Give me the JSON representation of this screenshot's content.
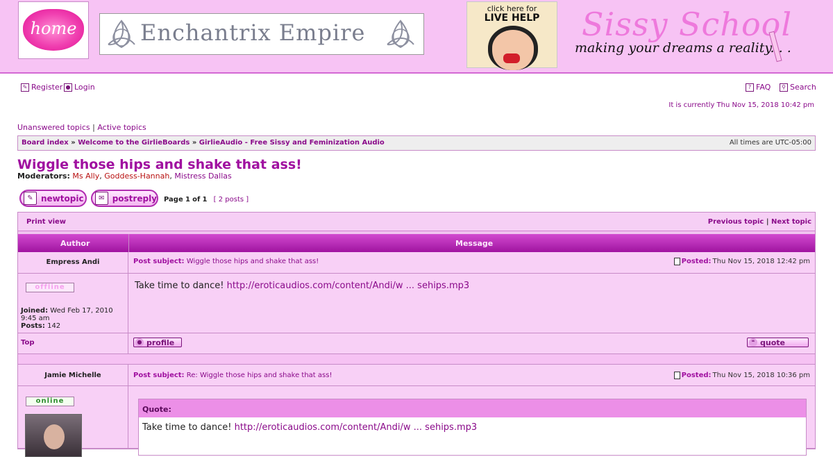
{
  "header": {
    "home_label": "home",
    "empire_title": "Enchantrix Empire",
    "livehelp_line1": "click here for",
    "livehelp_line2": "LIVE HELP",
    "sissy_title": "Sissy School",
    "sissy_tagline": "making your dreams a reality. . ."
  },
  "nav": {
    "register": "Register",
    "login": "Login",
    "faq": "FAQ",
    "search": "Search",
    "current_time": "It is currently Thu Nov 15, 2018 10:42 pm",
    "unanswered": "Unanswered topics",
    "separator": "|",
    "active": "Active topics"
  },
  "breadcrumb": {
    "board_index": "Board index",
    "sep": "»",
    "welcome": "Welcome to the GirlieBoards",
    "forum": "GirlieAudio - Free Sissy and Feminization Audio",
    "timezone": "All times are UTC-05:00"
  },
  "topic": {
    "title": "Wiggle those hips and shake that ass!",
    "moderators_label": "Moderators:",
    "moderators": [
      "Ms Ally",
      "Goddess-Hannah",
      "Mistress Dallas"
    ],
    "new_topic_label": "newtopic",
    "post_reply_label": "postreply",
    "page_prefix": "Page",
    "page_current": "1",
    "page_of": "of",
    "page_total": "1",
    "post_count": "[ 2 posts ]"
  },
  "table": {
    "print_view": "Print view",
    "previous_topic": "Previous topic",
    "next_topic": "Next topic",
    "nav_sep": "|",
    "col_author": "Author",
    "col_message": "Message",
    "top_label": "Top",
    "profile_label": "profile",
    "quote_label": "quote"
  },
  "posts": [
    {
      "author": "Empress Andi",
      "subject_label": "Post subject:",
      "subject": "Wiggle those hips and shake that ass!",
      "posted_label": "Posted:",
      "posted": "Thu Nov 15, 2018 12:42 pm",
      "status": "offline",
      "joined_label": "Joined:",
      "joined": "Wed Feb 17, 2010 9:45 am",
      "posts_label": "Posts:",
      "posts": "142",
      "body_text": "Take time to dance!",
      "body_link": "http://eroticaudios.com/content/Andi/w ... sehips.mp3"
    },
    {
      "author": "Jamie Michelle",
      "subject_label": "Post subject:",
      "subject": "Re: Wiggle those hips and shake that ass!",
      "posted_label": "Posted:",
      "posted": "Thu Nov 15, 2018 10:36 pm",
      "status": "online",
      "quote_header": "Quote:",
      "quote_text": "Take time to dance!",
      "quote_link": "http://eroticaudios.com/content/Andi/w ... sehips.mp3"
    }
  ]
}
